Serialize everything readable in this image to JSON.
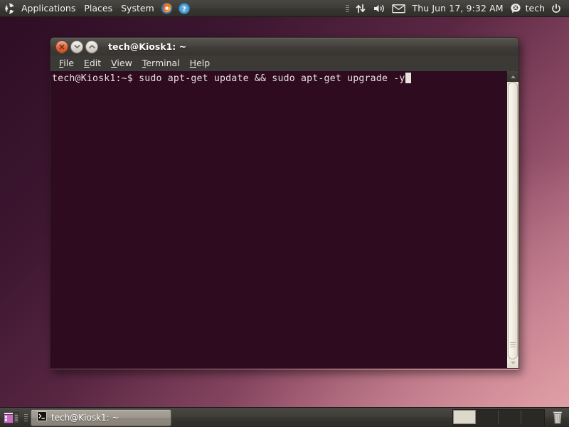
{
  "desktop": {
    "wallpaper_colors": {
      "top_left": "#2d0d24",
      "bottom_right": "#e0a6ab"
    }
  },
  "top_panel": {
    "logo": "ubuntu-logo",
    "menus": [
      {
        "label": "Applications",
        "name": "applications-menu"
      },
      {
        "label": "Places",
        "name": "places-menu"
      },
      {
        "label": "System",
        "name": "system-menu"
      }
    ],
    "launchers": [
      {
        "name": "firefox-launcher",
        "icon": "firefox-icon"
      },
      {
        "name": "help-launcher",
        "icon": "help-icon"
      }
    ],
    "indicators": [
      {
        "name": "network-indicator",
        "icon": "network-arrows-icon"
      },
      {
        "name": "volume-indicator",
        "icon": "speaker-icon"
      },
      {
        "name": "messaging-indicator",
        "icon": "envelope-icon"
      }
    ],
    "clock": "Thu Jun 17,  9:32 AM",
    "user": "tech",
    "power_icon": "power-icon"
  },
  "window": {
    "title": "tech@Kiosk1: ~",
    "controls": {
      "close": "close-icon",
      "minimize": "minimize-icon",
      "maximize": "maximize-icon"
    },
    "menubar": [
      {
        "name": "menu-file",
        "pre": "",
        "mnemonic": "F",
        "post": "ile"
      },
      {
        "name": "menu-edit",
        "pre": "",
        "mnemonic": "E",
        "post": "dit"
      },
      {
        "name": "menu-view",
        "pre": "",
        "mnemonic": "V",
        "post": "iew"
      },
      {
        "name": "menu-terminal",
        "pre": "",
        "mnemonic": "T",
        "post": "erminal"
      },
      {
        "name": "menu-help",
        "pre": "",
        "mnemonic": "H",
        "post": "elp"
      }
    ],
    "terminal": {
      "prompt": "tech@Kiosk1:~$ ",
      "command": "sudo apt-get update && sudo apt-get upgrade -y",
      "background_color": "#2e0b1e",
      "foreground_color": "#e8e2dd"
    }
  },
  "bottom_panel": {
    "show_desktop": "show-desktop-icon",
    "tasks": [
      {
        "label": "tech@Kiosk1: ~",
        "icon": "terminal-icon",
        "active": true
      }
    ],
    "workspaces": [
      {
        "name": "workspace-1",
        "active": true
      },
      {
        "name": "workspace-2",
        "active": false
      },
      {
        "name": "workspace-3",
        "active": false
      },
      {
        "name": "workspace-4",
        "active": false
      }
    ],
    "trash": "trash-icon"
  }
}
